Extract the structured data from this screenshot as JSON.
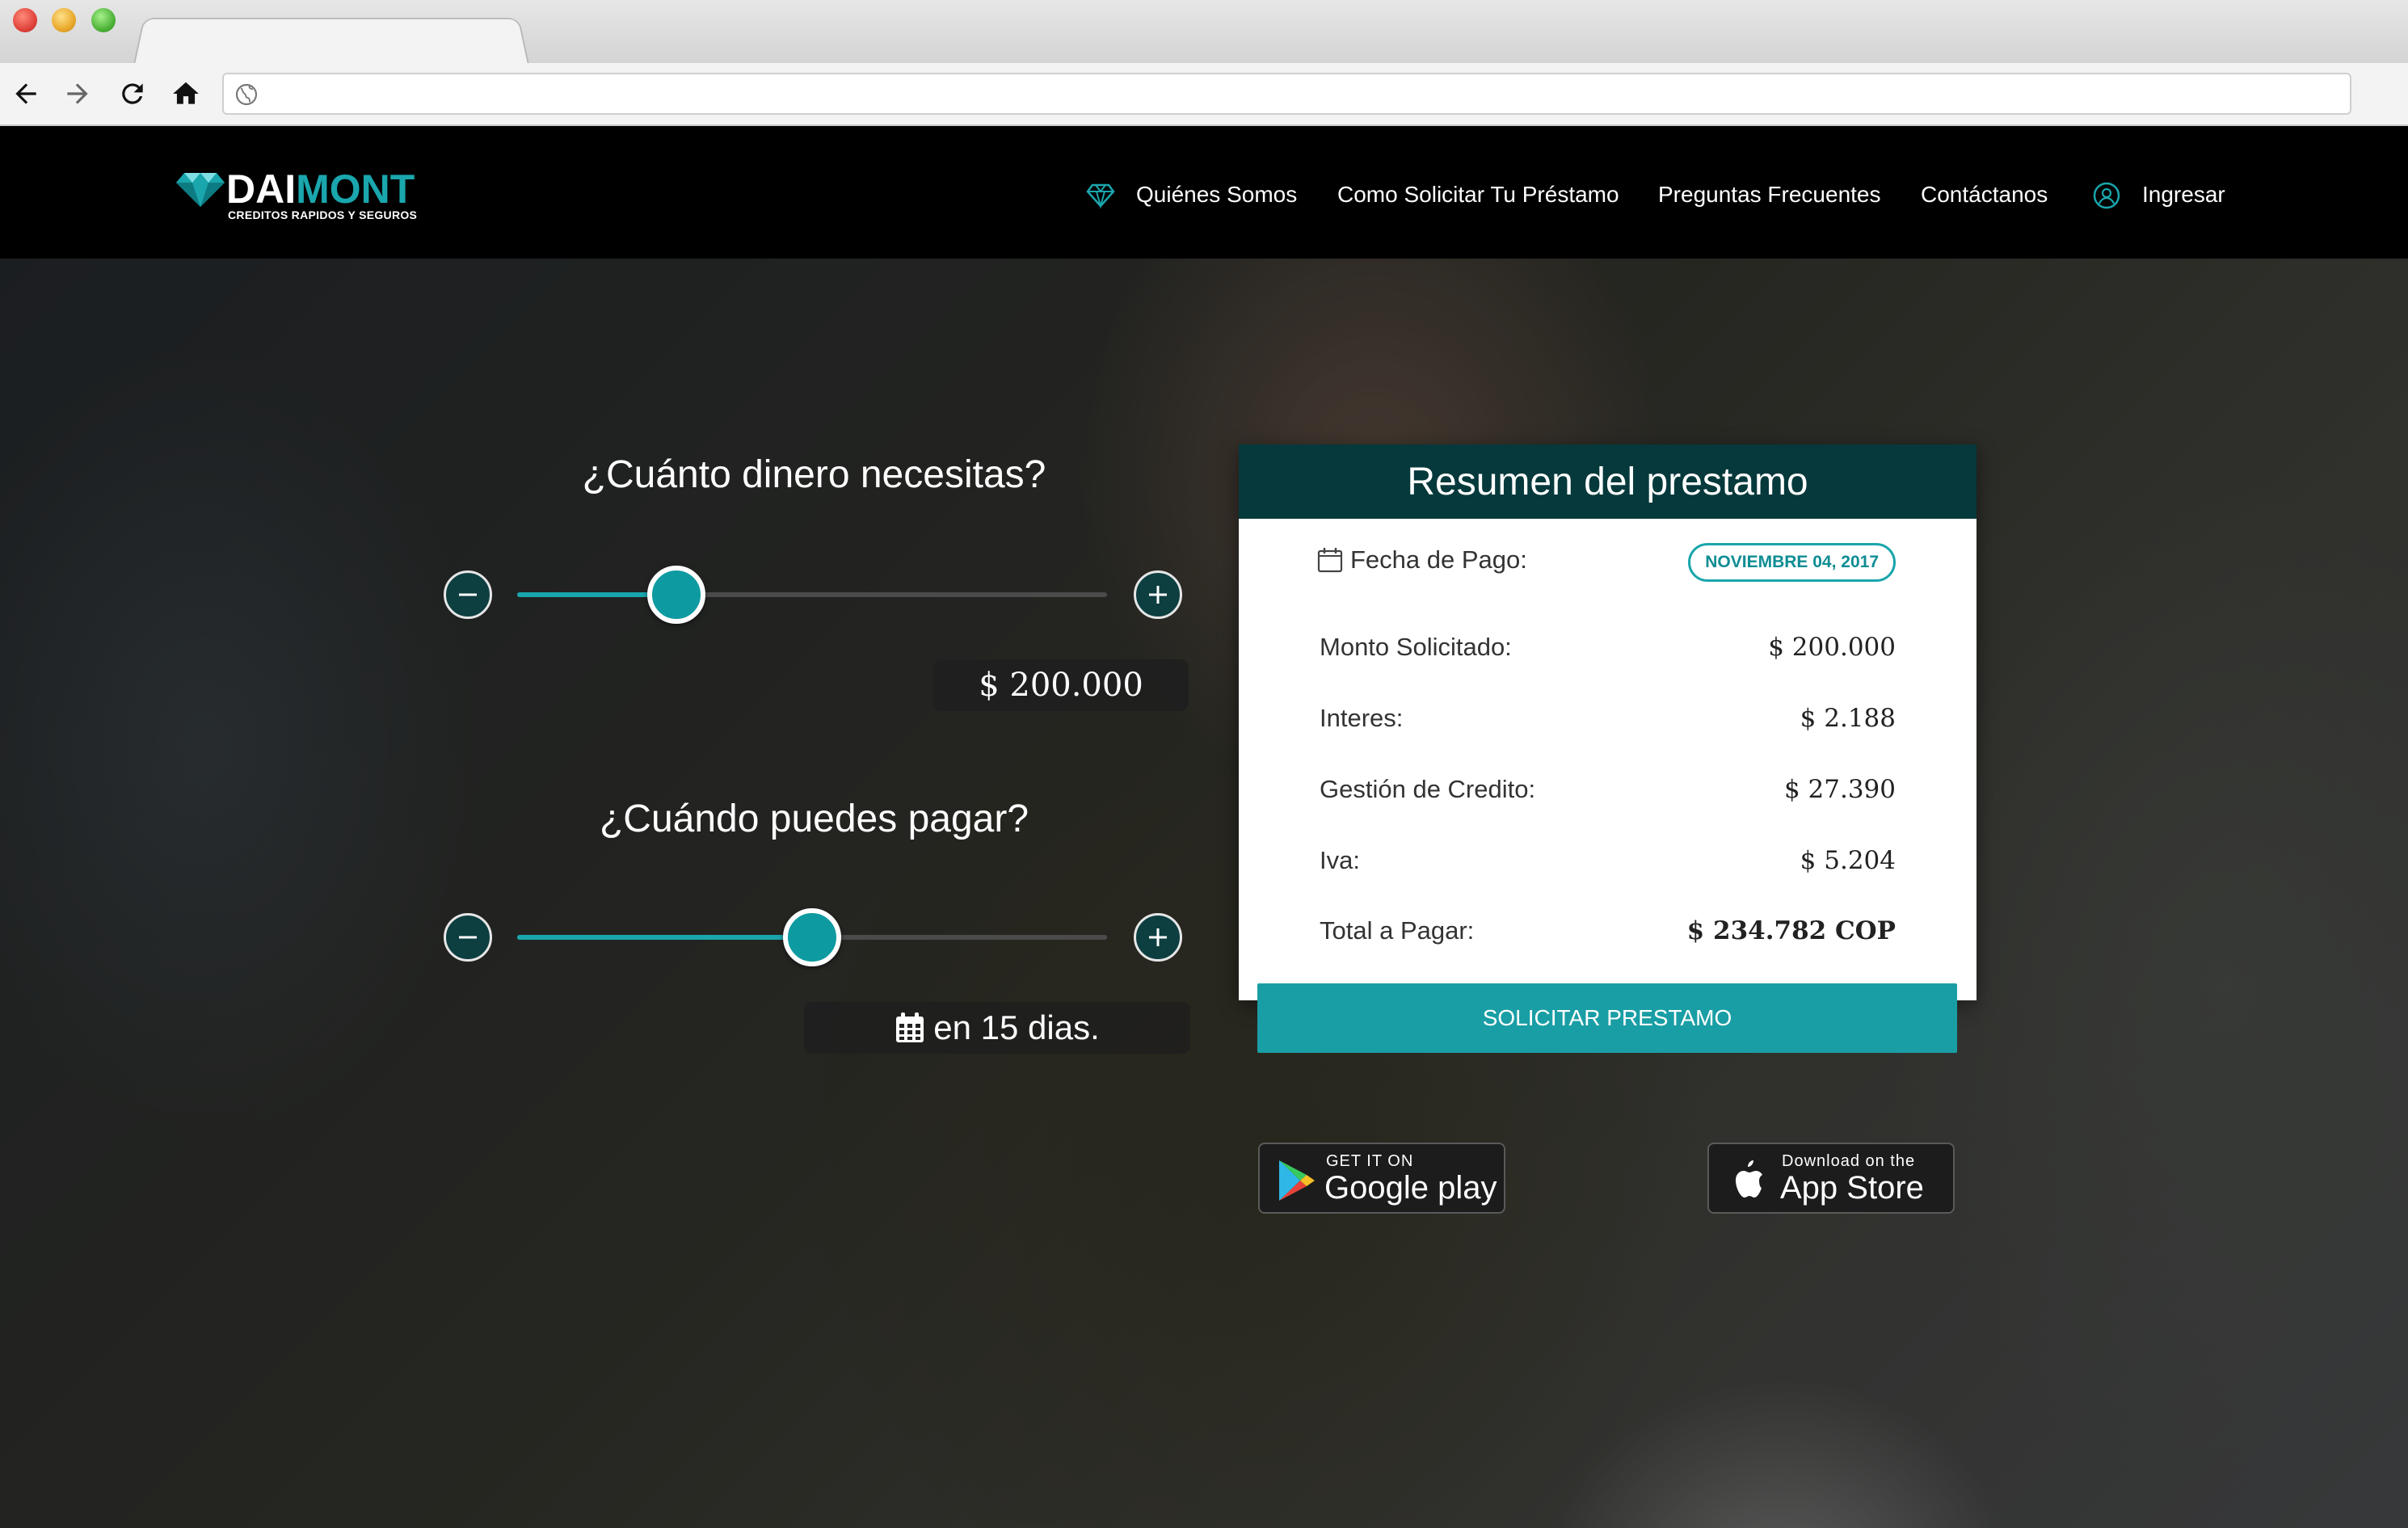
{
  "site": {
    "logo_primary": "DAI",
    "logo_accent": "MONT",
    "tagline": "CREDITOS RAPIDOS Y SEGUROS"
  },
  "nav": {
    "items": [
      {
        "label": "Quiénes Somos",
        "icon": "diamond-icon"
      },
      {
        "label": "Como Solicitar Tu Préstamo"
      },
      {
        "label": "Preguntas Frecuentes"
      },
      {
        "label": "Contáctanos"
      },
      {
        "label": "Ingresar",
        "icon": "user-circle-icon"
      }
    ]
  },
  "loan": {
    "amount_question": "¿Cuánto dinero necesitas?",
    "amount_value": "$  200.000",
    "amount_slider_fraction": 0.27,
    "term_question": "¿Cuándo puedes pagar?",
    "term_value": "en 15 dias.",
    "term_slider_fraction": 0.5
  },
  "summary": {
    "title": "Resumen del prestamo",
    "date_label": "Fecha de Pago:",
    "date_value": "NOVIEMBRE 04, 2017",
    "rows": [
      {
        "label": "Monto Solicitado:",
        "value": "$  200.000"
      },
      {
        "label": "Interes:",
        "value": "$  2.188"
      },
      {
        "label": "Gestión de Credito:",
        "value": "$  27.390"
      },
      {
        "label": "Iva:",
        "value": "$  5.204"
      },
      {
        "label": "Total a Pagar:",
        "value": "$  234.782 COP"
      }
    ],
    "cta": "SOLICITAR PRESTAMO"
  },
  "stores": {
    "google_small": "GET IT ON",
    "google_large": "Google play",
    "apple_small": "Download on the",
    "apple_large": "App Store"
  },
  "colors": {
    "accent": "#1aa6ad",
    "header_dark": "#06393b",
    "cta": "#1a9ea5"
  }
}
